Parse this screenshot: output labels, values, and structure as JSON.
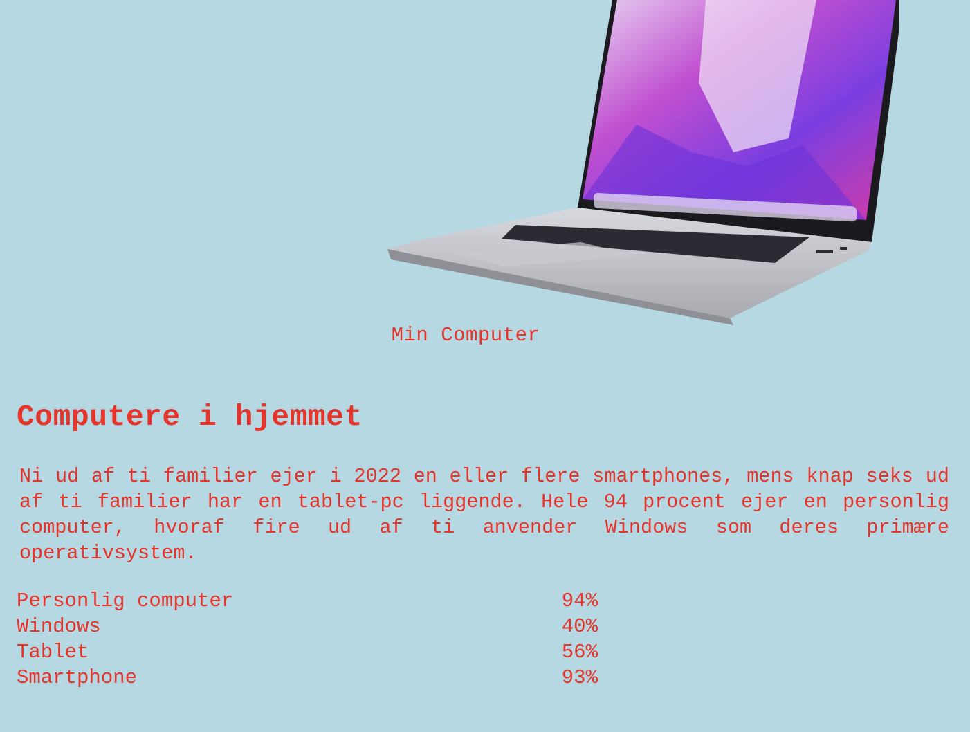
{
  "figure": {
    "image_name": "laptop-computer",
    "caption": "Min Computer"
  },
  "section": {
    "heading": "Computere i hjemmet",
    "intro": "Ni ud af ti familier ejer i 2022 en eller flere smartphones, mens knap seks ud af ti familier har en tablet-pc liggende. Hele 94 procent ejer en personlig computer, hvoraf fire ud af ti anvender Windows som deres primære operativsystem."
  },
  "stats": [
    {
      "label": "Personlig computer",
      "value": "94%"
    },
    {
      "label": "Windows",
      "value": "40%"
    },
    {
      "label": "Tablet",
      "value": "56%"
    },
    {
      "label": "Smartphone",
      "value": "93%"
    }
  ],
  "colors": {
    "background": "#b6d8e3",
    "text": "#e5352b"
  }
}
